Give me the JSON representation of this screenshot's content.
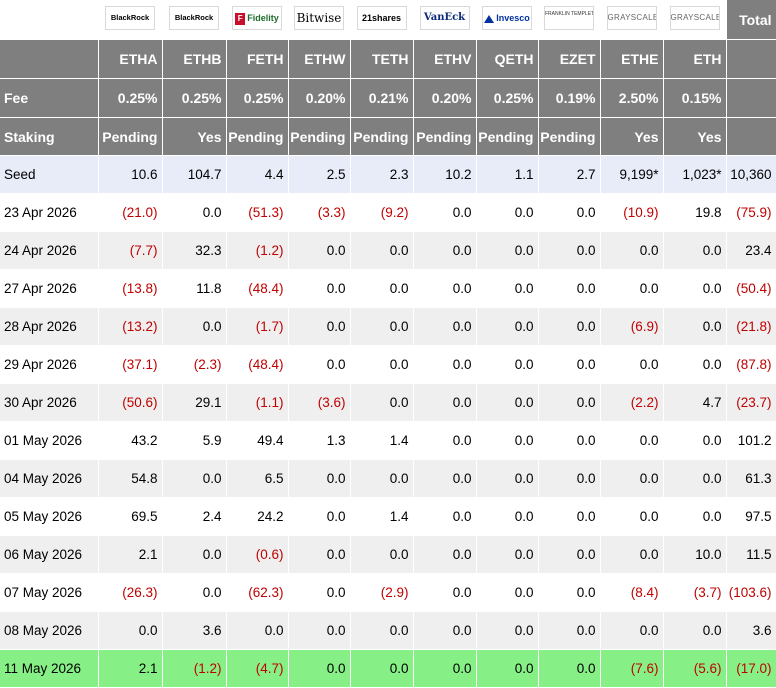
{
  "header": {
    "logos": [
      {
        "fund": "BlackRock",
        "text": "BlackRock"
      },
      {
        "fund": "BlackRock",
        "text": "BlackRock"
      },
      {
        "fund": "Fidelity",
        "text": "Fidelity"
      },
      {
        "fund": "Bitwise",
        "text": "Bitwise"
      },
      {
        "fund": "21shares",
        "text": "21shares"
      },
      {
        "fund": "VanEck",
        "text": "VanEck"
      },
      {
        "fund": "Invesco",
        "text": "Invesco"
      },
      {
        "fund": "Franklin Templeton",
        "text": "FRANKLIN TEMPLETON"
      },
      {
        "fund": "Grayscale",
        "text": "GRAYSCALE"
      },
      {
        "fund": "Grayscale",
        "text": "GRAYSCALE"
      }
    ],
    "total_label": "Total",
    "tickers": [
      "ETHA",
      "ETHB",
      "FETH",
      "ETHW",
      "TETH",
      "ETHV",
      "QETH",
      "EZET",
      "ETHE",
      "ETH"
    ],
    "fee_label": "Fee",
    "fees": [
      "0.25%",
      "0.25%",
      "0.25%",
      "0.20%",
      "0.21%",
      "0.20%",
      "0.25%",
      "0.19%",
      "2.50%",
      "0.15%"
    ],
    "staking_label": "Staking",
    "staking": [
      "Pending",
      "Yes",
      "Pending",
      "Pending",
      "Pending",
      "Pending",
      "Pending",
      "Pending",
      "Yes",
      "Yes"
    ]
  },
  "seed": {
    "label": "Seed",
    "values": [
      "10.6",
      "104.7",
      "4.4",
      "2.5",
      "2.3",
      "10.2",
      "1.1",
      "2.7",
      "9,199*",
      "1,023*",
      "10,360"
    ]
  },
  "rows": [
    {
      "date": "23 Apr 2026",
      "values": [
        "(21.0)",
        "0.0",
        "(51.3)",
        "(3.3)",
        "(9.2)",
        "0.0",
        "0.0",
        "0.0",
        "(10.9)",
        "19.8",
        "(75.9)"
      ]
    },
    {
      "date": "24 Apr 2026",
      "values": [
        "(7.7)",
        "32.3",
        "(1.2)",
        "0.0",
        "0.0",
        "0.0",
        "0.0",
        "0.0",
        "0.0",
        "0.0",
        "23.4"
      ]
    },
    {
      "date": "27 Apr 2026",
      "values": [
        "(13.8)",
        "11.8",
        "(48.4)",
        "0.0",
        "0.0",
        "0.0",
        "0.0",
        "0.0",
        "0.0",
        "0.0",
        "(50.4)"
      ]
    },
    {
      "date": "28 Apr 2026",
      "values": [
        "(13.2)",
        "0.0",
        "(1.7)",
        "0.0",
        "0.0",
        "0.0",
        "0.0",
        "0.0",
        "(6.9)",
        "0.0",
        "(21.8)"
      ]
    },
    {
      "date": "29 Apr 2026",
      "values": [
        "(37.1)",
        "(2.3)",
        "(48.4)",
        "0.0",
        "0.0",
        "0.0",
        "0.0",
        "0.0",
        "0.0",
        "0.0",
        "(87.8)"
      ]
    },
    {
      "date": "30 Apr 2026",
      "values": [
        "(50.6)",
        "29.1",
        "(1.1)",
        "(3.6)",
        "0.0",
        "0.0",
        "0.0",
        "0.0",
        "(2.2)",
        "4.7",
        "(23.7)"
      ]
    },
    {
      "date": "01 May 2026",
      "values": [
        "43.2",
        "5.9",
        "49.4",
        "1.3",
        "1.4",
        "0.0",
        "0.0",
        "0.0",
        "0.0",
        "0.0",
        "101.2"
      ]
    },
    {
      "date": "04 May 2026",
      "values": [
        "54.8",
        "0.0",
        "6.5",
        "0.0",
        "0.0",
        "0.0",
        "0.0",
        "0.0",
        "0.0",
        "0.0",
        "61.3"
      ]
    },
    {
      "date": "05 May 2026",
      "values": [
        "69.5",
        "2.4",
        "24.2",
        "0.0",
        "1.4",
        "0.0",
        "0.0",
        "0.0",
        "0.0",
        "0.0",
        "97.5"
      ]
    },
    {
      "date": "06 May 2026",
      "values": [
        "2.1",
        "0.0",
        "(0.6)",
        "0.0",
        "0.0",
        "0.0",
        "0.0",
        "0.0",
        "0.0",
        "10.0",
        "11.5"
      ]
    },
    {
      "date": "07 May 2026",
      "values": [
        "(26.3)",
        "0.0",
        "(62.3)",
        "0.0",
        "(2.9)",
        "0.0",
        "0.0",
        "0.0",
        "(8.4)",
        "(3.7)",
        "(103.6)"
      ]
    },
    {
      "date": "08 May 2026",
      "values": [
        "0.0",
        "3.6",
        "0.0",
        "0.0",
        "0.0",
        "0.0",
        "0.0",
        "0.0",
        "0.0",
        "0.0",
        "3.6"
      ]
    },
    {
      "date": "11 May 2026",
      "values": [
        "2.1",
        "(1.2)",
        "(4.7)",
        "0.0",
        "0.0",
        "0.0",
        "0.0",
        "0.0",
        "(7.6)",
        "(5.6)",
        "(17.0)"
      ],
      "highlight": true
    }
  ],
  "colors": {
    "header_bg": "#7f7f7f",
    "seed_bg": "#e7ecf8",
    "alt_row_bg": "#efefef",
    "highlight_bg": "#86f086",
    "negative": "#c00000"
  }
}
